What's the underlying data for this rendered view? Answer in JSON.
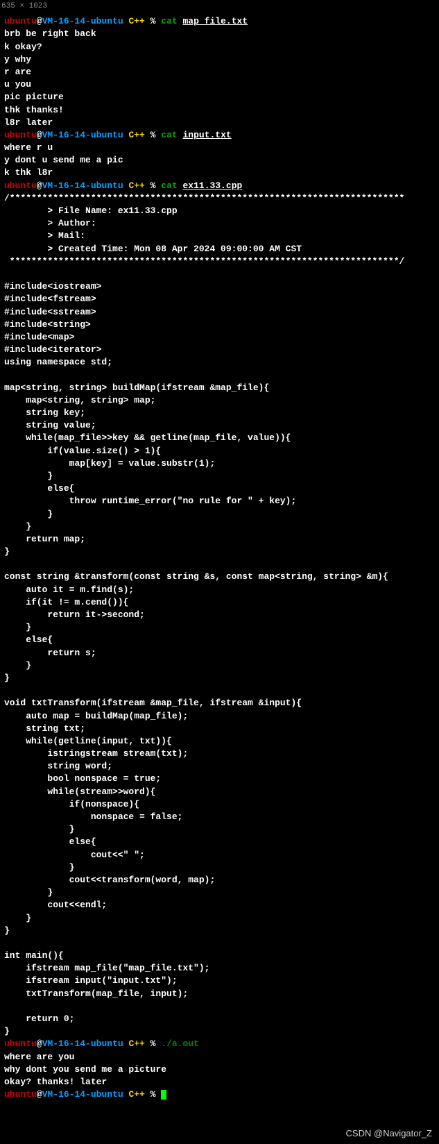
{
  "dim_badge": "635 × 1023",
  "prompt": {
    "user": "ubuntu",
    "at": "@",
    "host": "VM-16-14-ubuntu",
    "path": " C++ ",
    "percent": "% "
  },
  "cat": "cat ",
  "run": "./a.out",
  "files": {
    "map": "map_file.txt",
    "input": "input.txt",
    "cpp": "ex11.33.cpp"
  },
  "map_out": [
    "brb be right back",
    "k okay?",
    "y why",
    "r are",
    "u you",
    "pic picture",
    "thk thanks!",
    "l8r later"
  ],
  "input_out": [
    "where r u",
    "y dont u send me a pic",
    "k thk l8r"
  ],
  "cpp_out": [
    "/*************************************************************************",
    "        > File Name: ex11.33.cpp",
    "        > Author:",
    "        > Mail:",
    "        > Created Time: Mon 08 Apr 2024 09:00:00 AM CST",
    " ************************************************************************/",
    "",
    "#include<iostream>",
    "#include<fstream>",
    "#include<sstream>",
    "#include<string>",
    "#include<map>",
    "#include<iterator>",
    "using namespace std;",
    "",
    "map<string, string> buildMap(ifstream &map_file){",
    "    map<string, string> map;",
    "    string key;",
    "    string value;",
    "    while(map_file>>key && getline(map_file, value)){",
    "        if(value.size() > 1){",
    "            map[key] = value.substr(1);",
    "        }",
    "        else{",
    "            throw runtime_error(\"no rule for \" + key);",
    "        }",
    "    }",
    "    return map;",
    "}",
    "",
    "const string &transform(const string &s, const map<string, string> &m){",
    "    auto it = m.find(s);",
    "    if(it != m.cend()){",
    "        return it->second;",
    "    }",
    "    else{",
    "        return s;",
    "    }",
    "}",
    "",
    "void txtTransform(ifstream &map_file, ifstream &input){",
    "    auto map = buildMap(map_file);",
    "    string txt;",
    "    while(getline(input, txt)){",
    "        istringstream stream(txt);",
    "        string word;",
    "        bool nonspace = true;",
    "        while(stream>>word){",
    "            if(nonspace){",
    "                nonspace = false;",
    "            }",
    "            else{",
    "                cout<<\" \";",
    "            }",
    "            cout<<transform(word, map);",
    "        }",
    "        cout<<endl;",
    "    }",
    "}",
    "",
    "int main(){",
    "    ifstream map_file(\"map_file.txt\");",
    "    ifstream input(\"input.txt\");",
    "    txtTransform(map_file, input);",
    "",
    "    return 0;",
    "}"
  ],
  "run_out": [
    "where are you",
    "why dont you send me a picture",
    "okay? thanks! later"
  ],
  "watermark": "CSDN @Navigator_Z"
}
